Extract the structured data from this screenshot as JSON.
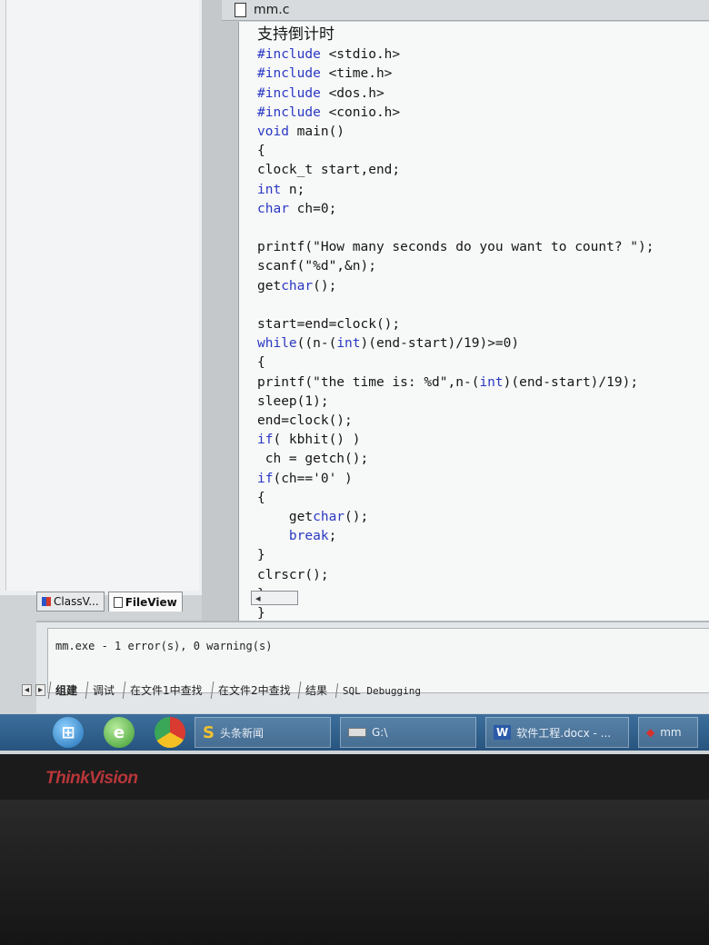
{
  "editor": {
    "file_name": "mm.c",
    "code_comment": "支持倒计时",
    "code_lines": [
      "#include <stdio.h>",
      "#include <time.h>",
      "#include <dos.h>",
      "#include <conio.h>",
      "void main()",
      "{",
      "clock_t start,end;",
      "int n;",
      "char ch=0;",
      "",
      "printf(\"How many seconds do you want to count? \");",
      "scanf(\"%d\",&n);",
      "getchar();",
      "",
      "start=end=clock();",
      "while((n-(int)(end-start)/19)>=0)",
      "{",
      "printf(\"the time is: %d\",n-(int)(end-start)/19);",
      "sleep(1);",
      "end=clock();",
      "if( kbhit() )",
      " ch = getch();",
      "if(ch=='0' )",
      "{",
      "    getchar();",
      "    break;",
      "}",
      "clrscr();",
      "}",
      "}"
    ],
    "keywords": [
      "#include",
      "void",
      "int",
      "char",
      "while",
      "if",
      "break"
    ]
  },
  "workspace": {
    "tabs": [
      {
        "label": "ClassV...",
        "icon": "class-view-icon"
      },
      {
        "label": "FileView",
        "icon": "file-view-icon"
      }
    ]
  },
  "output": {
    "message": "mm.exe - 1 error(s), 0 warning(s)",
    "tabs": [
      "组建",
      "调试",
      "在文件1中查找",
      "在文件2中查找",
      "结果",
      "SQL Debugging"
    ]
  },
  "taskbar": {
    "items": [
      {
        "label": "头条新闻",
        "icon": "news-app-icon"
      },
      {
        "label": "G:\\",
        "icon": "drive-icon"
      },
      {
        "label": "软件工程.docx - ...",
        "icon": "word-icon"
      },
      {
        "label": "mm",
        "icon": "vc-app-icon"
      }
    ]
  },
  "monitor": {
    "brand": "ThinkVision"
  }
}
